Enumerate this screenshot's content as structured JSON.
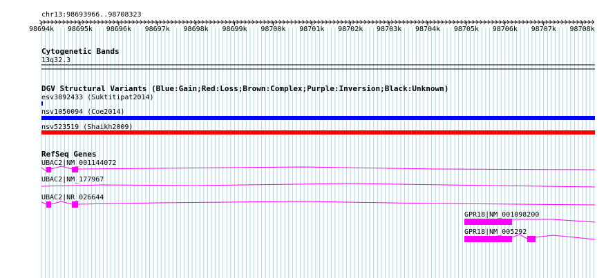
{
  "view": {
    "location": "chr13:98693966..98708323",
    "ruler_start": 98694,
    "ruler_end": 98708,
    "ruler_suffix": "k",
    "colors": {
      "grid": "#a8d8e0",
      "ruler": "#000000",
      "gene": "#ff00ff",
      "gain": "#0000ff",
      "loss": "#ff0000"
    }
  },
  "tracks": {
    "cytoband": {
      "title": "Cytogenetic Bands",
      "band_label": "13q32.3"
    },
    "dgv": {
      "title": "DGV Structural Variants (Blue:Gain;Red:Loss;Brown:Complex;Purple:Inversion;Black:Unknown)",
      "features": [
        {
          "label": "esv3892433 (Suktitipat2014)",
          "type": "gain"
        },
        {
          "label": "nsv1050094 (Coe2014)",
          "type": "gain"
        },
        {
          "label": "nsv523519 (Shaikh2009)",
          "type": "loss"
        }
      ]
    },
    "refseq": {
      "title": "RefSeq Genes",
      "genes": [
        {
          "label": "UBAC2|NM_001144072"
        },
        {
          "label": "UBAC2|NM_177967"
        },
        {
          "label": "UBAC2|NR_026644"
        },
        {
          "label": "GPR18|NM_001098200"
        },
        {
          "label": "GPR18|NM_005292"
        }
      ]
    }
  }
}
